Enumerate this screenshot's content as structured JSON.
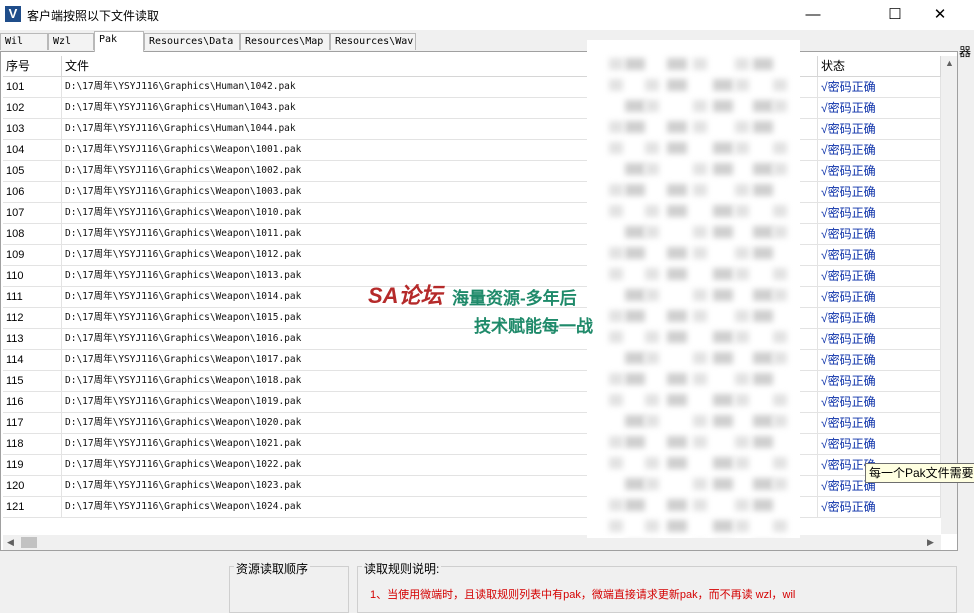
{
  "window": {
    "title": "客户端按照以下文件读取",
    "app_icon_letter": "V",
    "minimize_glyph": "—",
    "maximize_glyph": "☐",
    "close_glyph": "✕"
  },
  "tabs": [
    {
      "label": "Wil",
      "active": false
    },
    {
      "label": "Wzl",
      "active": false
    },
    {
      "label": "Pak",
      "active": true
    },
    {
      "label": "Resources\\Data",
      "active": false
    },
    {
      "label": "Resources\\Map",
      "active": false
    },
    {
      "label": "Resources\\Wav",
      "active": false
    }
  ],
  "edge_text": "器",
  "table": {
    "columns": {
      "index": "序号",
      "file": "文件",
      "status": "状态"
    },
    "rows": [
      {
        "index": "101",
        "file": "D:\\17周年\\YSYJ116\\Graphics\\Human\\1042.pak",
        "status": "√密码正确"
      },
      {
        "index": "102",
        "file": "D:\\17周年\\YSYJ116\\Graphics\\Human\\1043.pak",
        "status": "√密码正确"
      },
      {
        "index": "103",
        "file": "D:\\17周年\\YSYJ116\\Graphics\\Human\\1044.pak",
        "status": "√密码正确"
      },
      {
        "index": "104",
        "file": "D:\\17周年\\YSYJ116\\Graphics\\Weapon\\1001.pak",
        "status": "√密码正确"
      },
      {
        "index": "105",
        "file": "D:\\17周年\\YSYJ116\\Graphics\\Weapon\\1002.pak",
        "status": "√密码正确"
      },
      {
        "index": "106",
        "file": "D:\\17周年\\YSYJ116\\Graphics\\Weapon\\1003.pak",
        "status": "√密码正确"
      },
      {
        "index": "107",
        "file": "D:\\17周年\\YSYJ116\\Graphics\\Weapon\\1010.pak",
        "status": "√密码正确"
      },
      {
        "index": "108",
        "file": "D:\\17周年\\YSYJ116\\Graphics\\Weapon\\1011.pak",
        "status": "√密码正确"
      },
      {
        "index": "109",
        "file": "D:\\17周年\\YSYJ116\\Graphics\\Weapon\\1012.pak",
        "status": "√密码正确"
      },
      {
        "index": "110",
        "file": "D:\\17周年\\YSYJ116\\Graphics\\Weapon\\1013.pak",
        "status": "√密码正确"
      },
      {
        "index": "111",
        "file": "D:\\17周年\\YSYJ116\\Graphics\\Weapon\\1014.pak",
        "status": "√密码正确"
      },
      {
        "index": "112",
        "file": "D:\\17周年\\YSYJ116\\Graphics\\Weapon\\1015.pak",
        "status": "√密码正确"
      },
      {
        "index": "113",
        "file": "D:\\17周年\\YSYJ116\\Graphics\\Weapon\\1016.pak",
        "status": "√密码正确"
      },
      {
        "index": "114",
        "file": "D:\\17周年\\YSYJ116\\Graphics\\Weapon\\1017.pak",
        "status": "√密码正确"
      },
      {
        "index": "115",
        "file": "D:\\17周年\\YSYJ116\\Graphics\\Weapon\\1018.pak",
        "status": "√密码正确"
      },
      {
        "index": "116",
        "file": "D:\\17周年\\YSYJ116\\Graphics\\Weapon\\1019.pak",
        "status": "√密码正确"
      },
      {
        "index": "117",
        "file": "D:\\17周年\\YSYJ116\\Graphics\\Weapon\\1020.pak",
        "status": "√密码正确"
      },
      {
        "index": "118",
        "file": "D:\\17周年\\YSYJ116\\Graphics\\Weapon\\1021.pak",
        "status": "√密码正确"
      },
      {
        "index": "119",
        "file": "D:\\17周年\\YSYJ116\\Graphics\\Weapon\\1022.pak",
        "status": "√密码正确"
      },
      {
        "index": "120",
        "file": "D:\\17周年\\YSYJ116\\Graphics\\Weapon\\1023.pak",
        "status": "√密码正确"
      },
      {
        "index": "121",
        "file": "D:\\17周年\\YSYJ116\\Graphics\\Weapon\\1024.pak",
        "status": "√密码正确"
      }
    ]
  },
  "tooltip": "每一个Pak文件需要",
  "watermark": {
    "logo": "SA论坛",
    "line1": "海量资源-多年后",
    "line2": "技术赋能每一战"
  },
  "bottom": {
    "order_title": "资源读取顺序",
    "rules_title": "读取规则说明:",
    "rule_1": "1、当使用微端时，且读取规则列表中有pak，微端直接请求更新pak，而不再读 wzl，wil"
  },
  "colors": {
    "status_text": "#0a2fa8",
    "rule_text": "#d40000",
    "app_icon": "#1f4d8a"
  }
}
